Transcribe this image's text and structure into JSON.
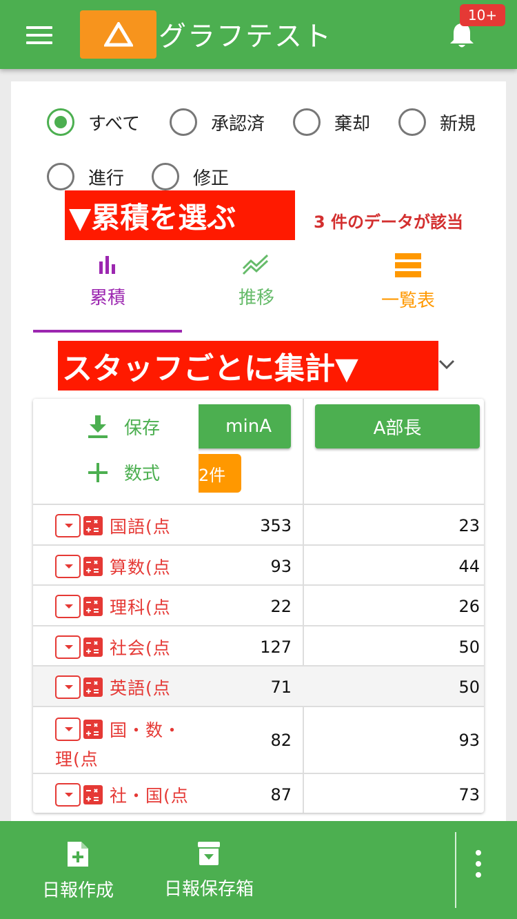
{
  "header": {
    "app_title": "グラフテスト",
    "notification_badge": "10+"
  },
  "filters": [
    {
      "label": "すべて",
      "checked": true
    },
    {
      "label": "承認済",
      "checked": false
    },
    {
      "label": "棄却",
      "checked": false
    },
    {
      "label": "新規",
      "checked": false
    },
    {
      "label": "進行",
      "checked": false
    },
    {
      "label": "修正",
      "checked": false
    }
  ],
  "annotations": {
    "select_cumulative": "▼累積を選ぶ",
    "aggregate_by_staff": "スタッフごとに集計▼"
  },
  "result_count_text": "3 件のデータが該当",
  "tabs": [
    {
      "label": "累積",
      "active": true,
      "color": "#9c27b0"
    },
    {
      "label": "推移",
      "active": false,
      "color": "#66bb6a"
    },
    {
      "label": "一覧表",
      "active": false,
      "color": "#ff9800"
    }
  ],
  "popup_menu": [
    {
      "label": "保存",
      "icon": "download-icon"
    },
    {
      "label": "数式",
      "icon": "plus-icon"
    }
  ],
  "table": {
    "columns": [
      {
        "name": "minA",
        "count": "2件"
      },
      {
        "name": "A部長"
      }
    ],
    "rows": [
      {
        "label": "国語(点",
        "a": "353",
        "b": "23"
      },
      {
        "label": "算数(点",
        "a": "93",
        "b": "44"
      },
      {
        "label": "理科(点",
        "a": "22",
        "b": "26"
      },
      {
        "label": "社会(点",
        "a": "127",
        "b": "50"
      },
      {
        "label": "英語(点",
        "a": "71",
        "b": "50"
      },
      {
        "label_line1": "国・数・",
        "label_line2": "理(点",
        "a": "82",
        "b": "93"
      },
      {
        "label": "社・国(点",
        "a": "87",
        "b": "73"
      }
    ]
  },
  "footer": {
    "create_report": "日報作成",
    "report_storage": "日報保存箱"
  },
  "colors": {
    "primary": "#4caf50",
    "accent_orange": "#f7941d",
    "annotation_red": "#ff1a00",
    "purple": "#9c27b0"
  }
}
